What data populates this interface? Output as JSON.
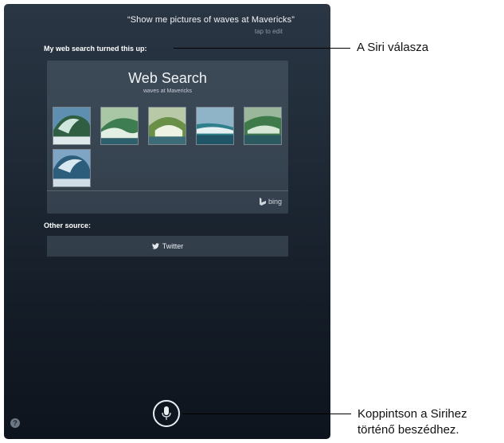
{
  "siri": {
    "query": "“Show me pictures of waves at Mavericks”",
    "tap_to_edit": "tap to edit",
    "response_intro": "My web search turned this up:",
    "web_search": {
      "title": "Web Search",
      "subtitle": "waves at Mavericks",
      "provider": "bing",
      "thumbnails": [
        "wave-1",
        "wave-2",
        "wave-3",
        "wave-4",
        "wave-5",
        "wave-6"
      ]
    },
    "other_source_label": "Other source:",
    "twitter_label": "Twitter",
    "help_glyph": "?"
  },
  "callouts": {
    "siri_response": "A Siri válasza",
    "tap_siri_line1": "Koppintson a Sirihez",
    "tap_siri_line2": "történő beszédhez."
  },
  "icons": {
    "mic": "microphone-icon",
    "bing": "bing-logo-icon",
    "twitter": "twitter-bird-icon",
    "help": "help-icon"
  }
}
